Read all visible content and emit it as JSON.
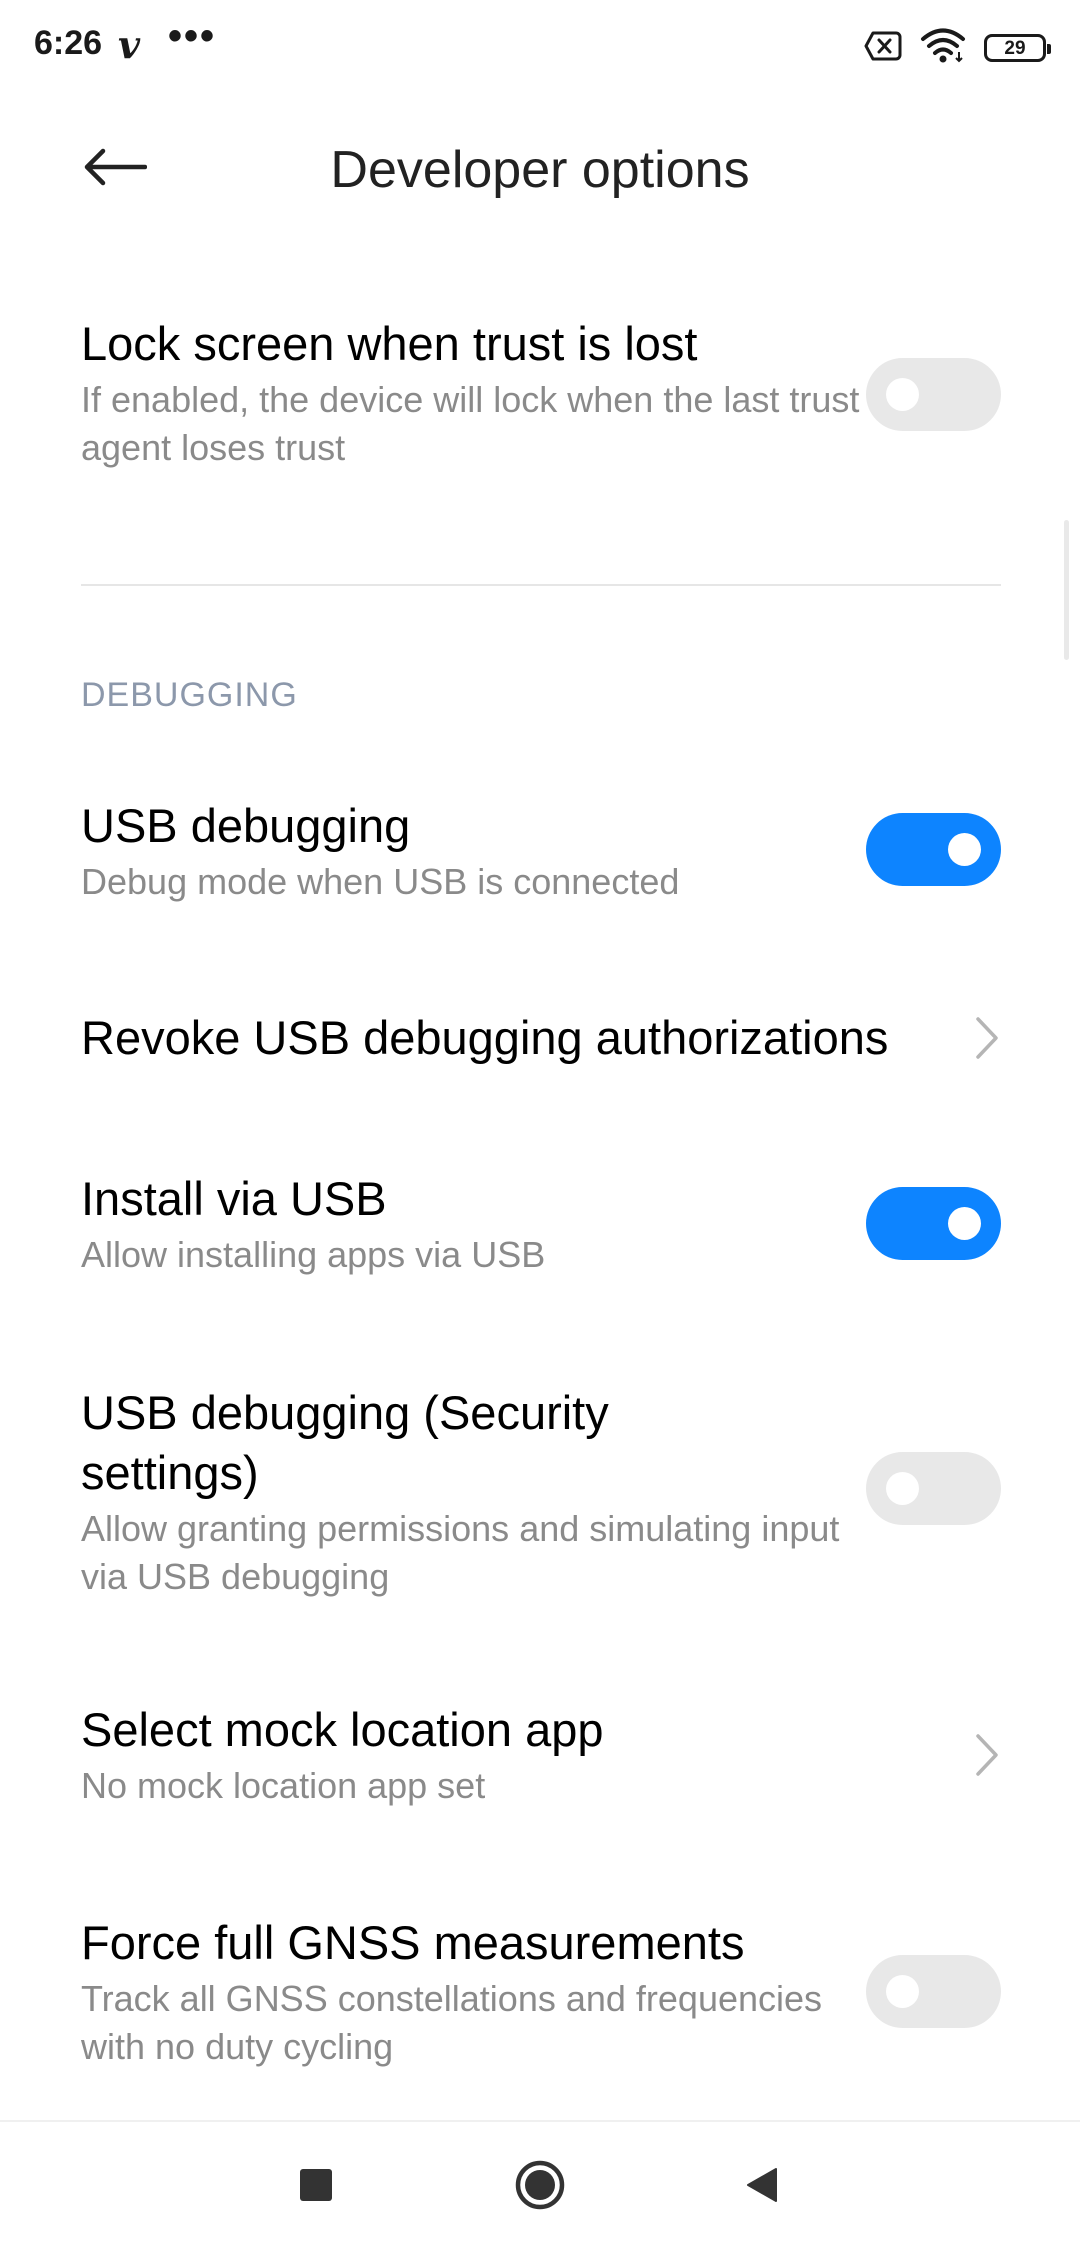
{
  "status_bar": {
    "time": "6:26",
    "app_glyph": "v",
    "more_glyph": "•••",
    "battery_level": "29",
    "icons": [
      "sim-off-icon",
      "wifi-icon",
      "battery-icon"
    ]
  },
  "header": {
    "title": "Developer options",
    "back_icon": "arrow-left-icon"
  },
  "settings_top": [
    {
      "title": "Lock screen when trust is lost",
      "summary": "If enabled, the device will lock when the last trust agent loses trust",
      "control": "switch",
      "state": "off"
    }
  ],
  "section": {
    "header": "DEBUGGING"
  },
  "settings": [
    {
      "title": "USB debugging",
      "summary": "Debug mode when USB is connected",
      "control": "switch",
      "state": "on"
    },
    {
      "title": "Revoke USB debugging authorizations",
      "summary": "",
      "control": "chevron"
    },
    {
      "title": "Install via USB",
      "summary": "Allow installing apps via USB",
      "control": "switch",
      "state": "on"
    },
    {
      "title": "USB debugging (Security settings)",
      "summary": "Allow granting permissions and simulating input via USB debugging",
      "control": "switch",
      "state": "off"
    },
    {
      "title": "Select mock location app",
      "summary": "No mock location app set",
      "control": "chevron"
    },
    {
      "title": "Force full GNSS measurements",
      "summary": "Track all GNSS constellations and frequencies with no duty cycling",
      "control": "switch",
      "state": "off"
    }
  ],
  "colors": {
    "accent": "#0d84ff",
    "switch_off": "#e8e8e8",
    "summary_text": "#8a8a8a",
    "section_header": "#8c98ab"
  },
  "nav_bar": {
    "icons": [
      "recents-square-icon",
      "home-circle-icon",
      "back-triangle-icon"
    ]
  }
}
